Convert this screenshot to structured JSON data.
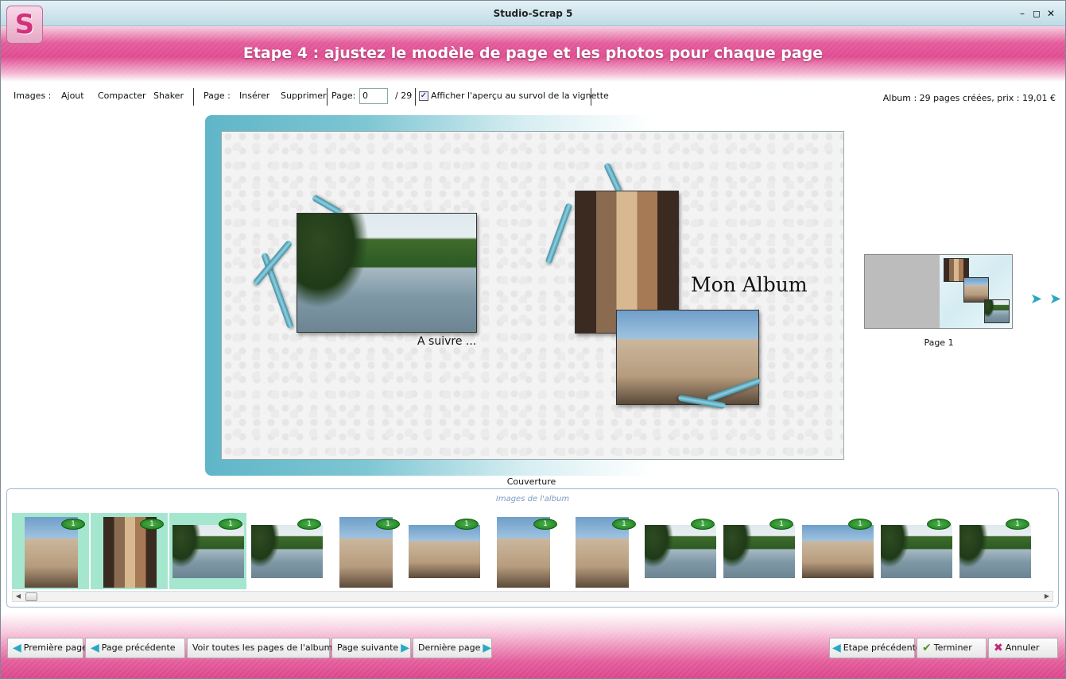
{
  "window": {
    "title": "Studio-Scrap 5",
    "icon_letter": "S"
  },
  "header": {
    "step_title": "Etape 4 : ajustez le modèle de page et les photos pour chaque page"
  },
  "toolbar": {
    "images_label": "Images :",
    "add": "Ajout",
    "compact": "Compacter",
    "shaker": "Shaker",
    "page_label": "Page :",
    "insert": "Insérer",
    "delete": "Supprimer",
    "page_field_label": "Page:",
    "page_value": "0",
    "page_total": "/ 29",
    "preview_checkbox_label": "Afficher l'aperçu au survol de la vignette",
    "preview_checked": true,
    "album_info": "Album : 29 pages créées, prix : 19,01 €"
  },
  "canvas": {
    "left_caption": "A suivre ...",
    "album_title": "Mon Album",
    "page_caption": "Couverture"
  },
  "next_page": {
    "caption": "Page 1"
  },
  "images_panel": {
    "title": "Images de l'album",
    "items": [
      {
        "count": "1",
        "selected": true
      },
      {
        "count": "1",
        "selected": true
      },
      {
        "count": "1",
        "selected": true
      },
      {
        "count": "1",
        "selected": false
      },
      {
        "count": "1",
        "selected": false
      },
      {
        "count": "1",
        "selected": false
      },
      {
        "count": "1",
        "selected": false
      },
      {
        "count": "1",
        "selected": false
      },
      {
        "count": "1",
        "selected": false
      },
      {
        "count": "1",
        "selected": false
      },
      {
        "count": "1",
        "selected": false
      },
      {
        "count": "1",
        "selected": false
      },
      {
        "count": "1",
        "selected": false
      }
    ]
  },
  "footer": {
    "first_page": "Première page",
    "prev_page": "Page précédente",
    "all_pages": "Voir toutes les pages de l'album",
    "next_page": "Page suivante",
    "last_page": "Dernière page",
    "prev_step": "Etape précédente",
    "finish": "Terminer",
    "cancel": "Annuler"
  },
  "colors": {
    "accent_pink": "#df4b90",
    "accent_teal": "#5fb6c8",
    "selected_thumb": "#a5e6cf"
  }
}
